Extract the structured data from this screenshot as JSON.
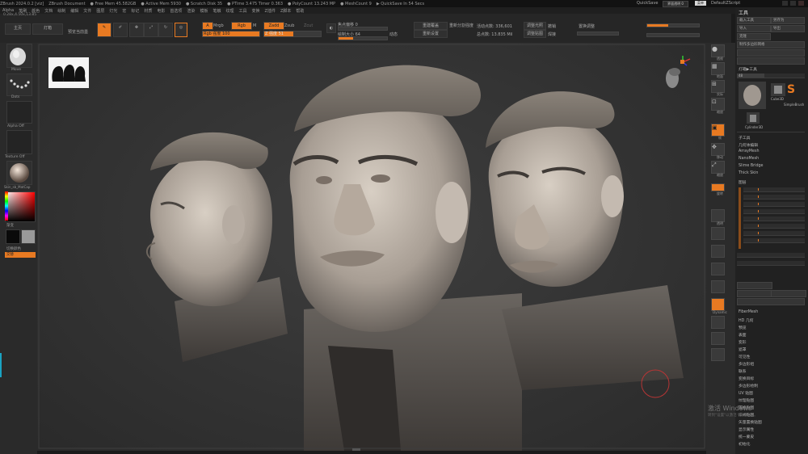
{
  "titlebar": {
    "items": [
      "ZBrush 2024.0.2 [viz]",
      "ZBrush Document",
      "● Free Mem 45.582GB",
      "● Active Mem 5930",
      "● Scratch Disk 35",
      "● PTime 3.475 Timer 0.363",
      "● PolyCount 13.243 MP",
      "● MeshCount 9",
      "▶ QuickSave In 54 Secs"
    ],
    "quicksave": "QuickSave",
    "pill": "界面透明 0",
    "menu_btn": "菜单",
    "script": "DefaultZScript"
  },
  "menubar": {
    "items": [
      "Alpha",
      "笔刷",
      "颜色",
      "文档",
      "绘制",
      "编辑",
      "文件",
      "图层",
      "灯光",
      "宏",
      "标记",
      "材质",
      "电影",
      "首选项",
      "渲染",
      "模板",
      "笔触",
      "纹理",
      "工具",
      "变换",
      "Z插件",
      "Z脚本",
      "帮助"
    ],
    "brush_size": "0.28x,4.50x,13.85"
  },
  "topbar": {
    "home": "主页",
    "lightbox": "灯箱",
    "open_recent": "预览当前墨",
    "tool_buttons": [
      "编辑",
      "绘制",
      "移动",
      "缩放",
      "旋转"
    ],
    "mode_a": "A",
    "mode_a_label": "Mrgb",
    "mode_rgb": "Rgb",
    "mode_m": "M",
    "zadd": "Zadd",
    "zsub": "Zsub",
    "zcut": "Zcut",
    "rgb_intensity": "Rgb 强度 100",
    "z_intensity": "Z 强度 51",
    "focal_shift": "焦点偏移 0",
    "draw_size": "绘制大小 64",
    "dynamic": "动态",
    "active_points": "活动点数: 336,601",
    "total_points": "总点数: 13.835 Mil",
    "backface": "重建覆盖",
    "reset": "重新设置",
    "adjust": "调整光照",
    "focus": "调整贴图",
    "smooth": "重新分割强度",
    "undo": "撤销",
    "weld": "焊接",
    "edit_mesh": "置换调整"
  },
  "leftshelf": {
    "brush_label": "Move",
    "stroke_label": "Dots",
    "alpha_label": "Alpha Off",
    "texture_label": "Texture Off",
    "material_label": "Skin_sb_MatCap",
    "gradient_label": "渐变",
    "switch_label": "切换颜色",
    "alternate_label": "交替"
  },
  "rightshelf": {
    "labels": [
      "透视",
      "地面",
      "实际",
      "缩放",
      "帧",
      "移动",
      "缩放",
      "旋转",
      "透明",
      "Dynamic"
    ]
  },
  "rightpanel": {
    "header": "工具",
    "buttons": [
      "载入工具",
      "另存为",
      "导入",
      "导出",
      "克隆",
      "制作多边形网格"
    ],
    "subtools": [
      "Cube3D",
      "SimpleBrush"
    ],
    "lightbox_tools": "灯箱▶工具",
    "cylinder": "Cylinder3D",
    "subtool_count": "48",
    "menu_sections": [
      "子工具",
      "几何体编辑",
      "ArrayMesh",
      "NanoMesh",
      "Slime Bridge",
      "Thick Skin",
      "图层"
    ],
    "lower_items": [
      "FiberMesh",
      "HD 几何",
      "预览",
      "表面",
      "变形",
      "遮罩",
      "可见性",
      "多边形组",
      "联系",
      "变换目标",
      "多边形绘制",
      "UV 贴图",
      "纹理贴图",
      "置换贴图",
      "法线贴图",
      "矢量置换贴图",
      "显示属性",
      "统一蒙皮",
      "初始化"
    ],
    "watermark": "激活 Windows",
    "watermark_sub": "转到\"设置\"以激活 Windows。"
  },
  "colors": {
    "accent": "#e87a22",
    "panel": "#262626",
    "viewport": "#333333"
  }
}
